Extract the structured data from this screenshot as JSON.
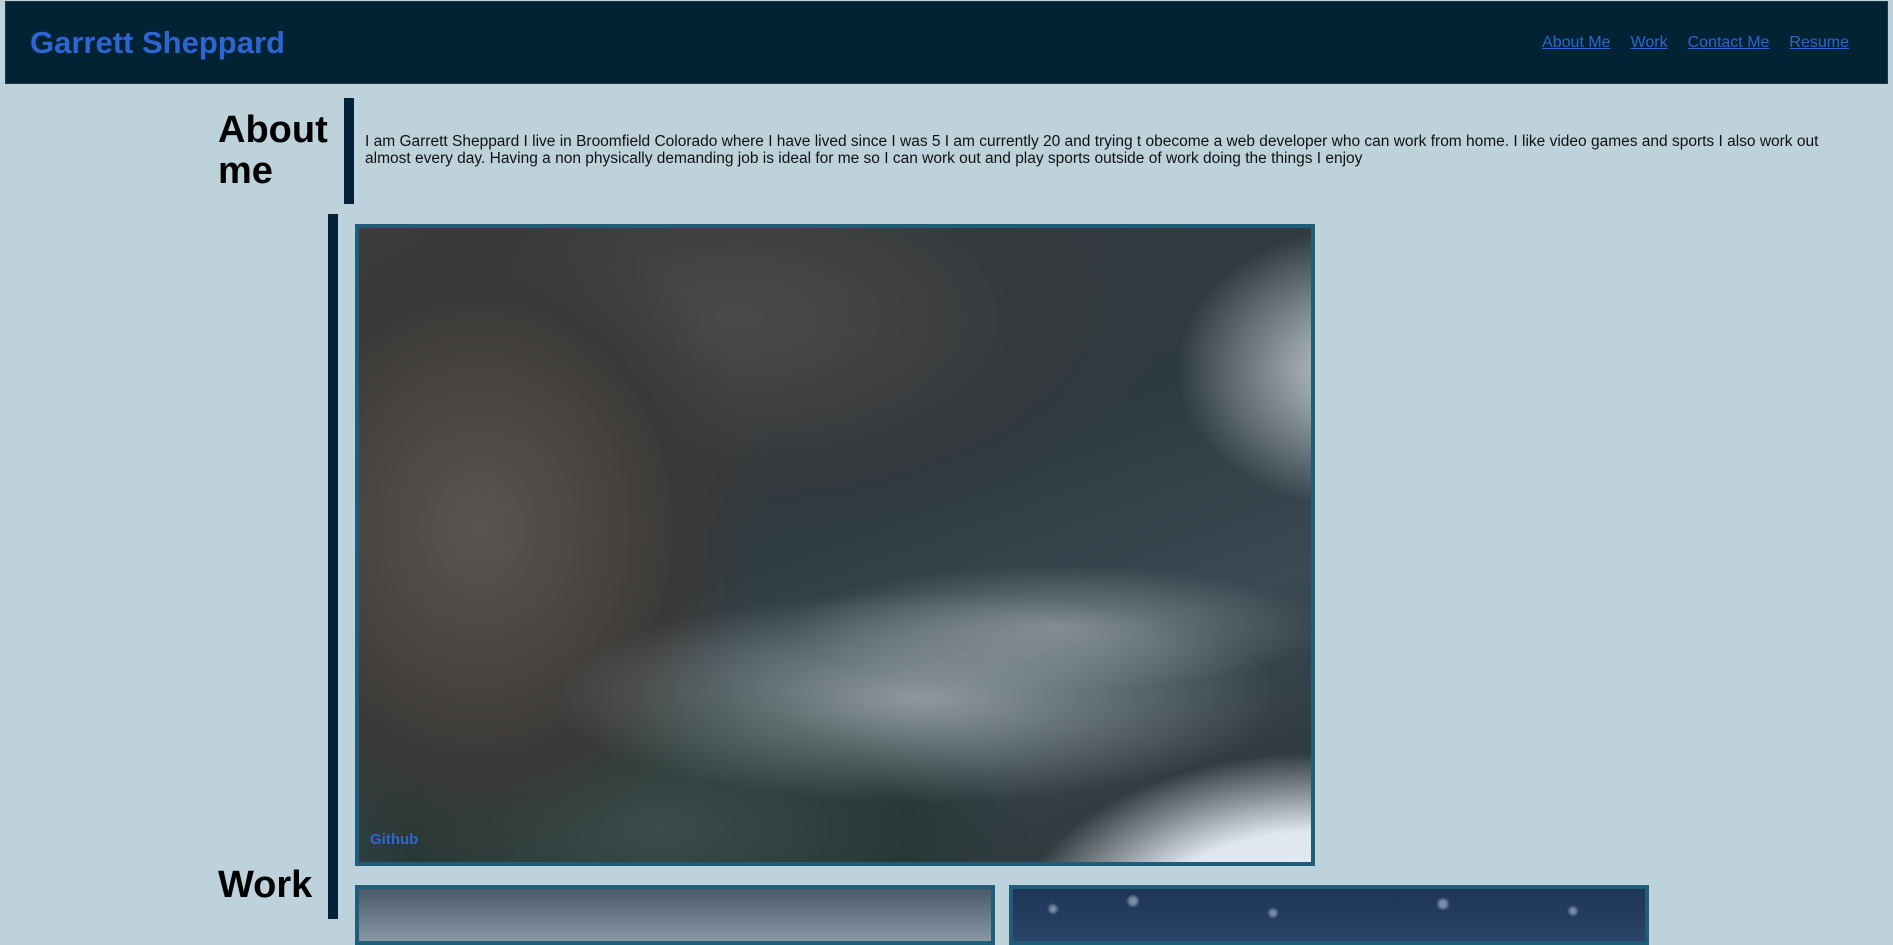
{
  "header": {
    "brand": "Garrett Sheppard",
    "nav": [
      {
        "label": "About Me"
      },
      {
        "label": "Work"
      },
      {
        "label": "Contact Me"
      },
      {
        "label": "Resume"
      }
    ]
  },
  "about": {
    "heading": "About me",
    "text": "I am Garrett Sheppard I live in Broomfield Colorado where I have lived since I was 5 I am currently 20 and trying t obecome a web developer who can work from home. I like video games and sports I also work out almost every day. Having a non physically demanding job is ideal for me so I can work out and play sports outside of work doing the things I enjoy"
  },
  "work": {
    "heading": "Work",
    "projects": [
      {
        "caption": "Github",
        "image": "snowy-river-photo"
      },
      {
        "caption": "",
        "image": "cloudy-sky-photo"
      },
      {
        "caption": "",
        "image": "water-droplets-photo"
      }
    ]
  },
  "colors": {
    "background": "#bdd2db",
    "header": "#012334",
    "link": "#2d66d3",
    "accent_bar": "#042237",
    "card_border": "#1f5d79"
  }
}
